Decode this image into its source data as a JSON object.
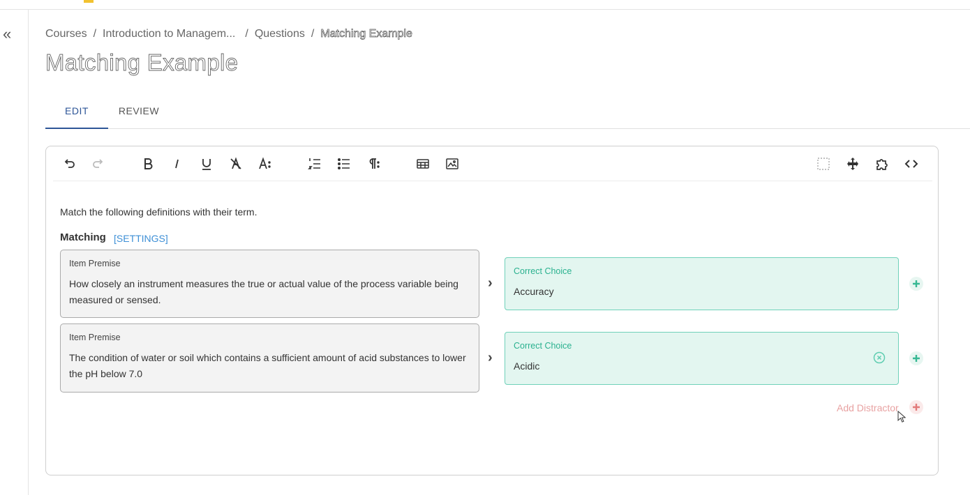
{
  "breadcrumb": {
    "items": [
      "Courses",
      "Introduction to Managem...",
      "Questions"
    ],
    "current": "Matching Example",
    "separator": "/"
  },
  "page": {
    "title": "Matching Example"
  },
  "tabs": [
    {
      "label": "EDIT",
      "active": true
    },
    {
      "label": "REVIEW",
      "active": false
    }
  ],
  "toolbar": {
    "icons": [
      "undo-icon",
      "redo-icon",
      "bold-icon",
      "italic-icon",
      "underline-icon",
      "clear-format-icon",
      "text-style-icon",
      "ordered-list-icon",
      "bullet-list-icon",
      "paragraph-icon",
      "table-icon",
      "image-icon",
      "select-icon",
      "move-icon",
      "puzzle-icon",
      "code-icon"
    ]
  },
  "question": {
    "prompt": "Match the following definitions with their term.",
    "matching_label": "Matching",
    "settings_label": "[SETTINGS]",
    "pairs": [
      {
        "premise_label": "Item Premise",
        "premise_text": "How closely an instrument measures the true or actual value of the process variable being measured or sensed.",
        "choice_label": "Correct Choice",
        "choice_text": "Accuracy"
      },
      {
        "premise_label": "Item Premise",
        "premise_text": "The condition of water or soil which contains a sufficient amount of acid substances to lower the pH below 7.0",
        "choice_label": "Correct Choice",
        "choice_text": "Acidic"
      }
    ],
    "add_distractor_label": "Add Distractor"
  },
  "colors": {
    "accent": "#2d5597",
    "choice_border": "#6fd1b9",
    "choice_bg": "#e3f6f0",
    "link": "#3d8fd6",
    "distractor": "#e8a2a2"
  }
}
